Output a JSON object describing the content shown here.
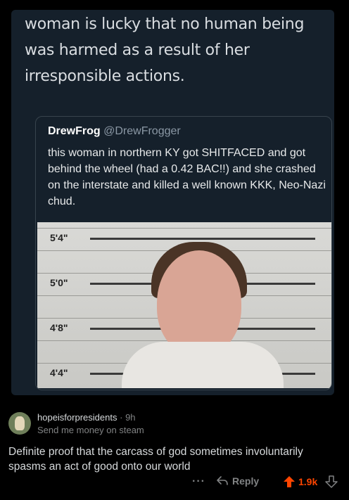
{
  "tweet": {
    "text": "woman is lucky that no human being was harmed as a result of her irresponsible actions.",
    "quoted": {
      "name": "DrewFrog",
      "handle": "@DrewFrogger",
      "text": "this woman in northern KY got SHITFACED and got behind the wheel (had a 0.42 BAC!!) and she crashed on the interstate and killed a well known KKK, Neo-Nazi chud.",
      "height_labels": [
        "5'4\"",
        "5'0\"",
        "4'8\"",
        "4'4\""
      ]
    }
  },
  "comment": {
    "username": "hopeisforpresidents",
    "separator": "·",
    "time": "9h",
    "flair": "Send me money on steam",
    "body": "Definite proof that the carcass of god sometimes involuntarily spasms an act of good onto our world",
    "more": "···",
    "reply_label": "Reply",
    "score": "1.9k",
    "icons": [
      "reply-icon",
      "upvote-icon",
      "downvote-icon",
      "avatar"
    ],
    "accent_color": "#ff4500"
  }
}
